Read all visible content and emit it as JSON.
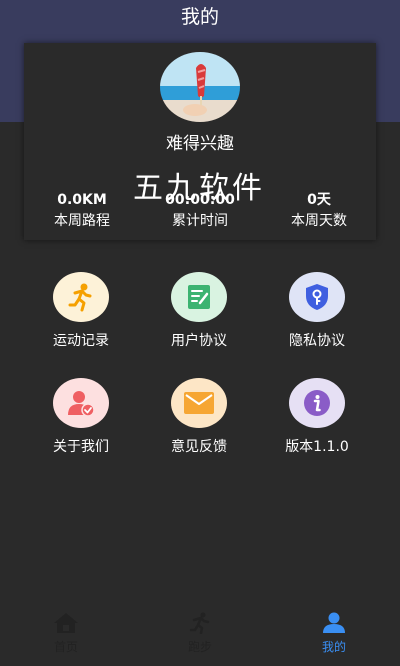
{
  "header": {
    "title": "我的"
  },
  "profile": {
    "username": "难得兴趣",
    "watermark": "五九软件",
    "stats": [
      {
        "value": "0.0KM",
        "label": "本周路程"
      },
      {
        "value": "00:00:00",
        "label": "累计时间"
      },
      {
        "value": "0天",
        "label": "本周天数"
      }
    ]
  },
  "menu": [
    {
      "label": "运动记录",
      "icon": "running-icon",
      "bg": "#fdf2d8",
      "color": "#f5a000"
    },
    {
      "label": "用户协议",
      "icon": "document-edit-icon",
      "bg": "#d9f3e1",
      "color": "#3cb371"
    },
    {
      "label": "隐私协议",
      "icon": "shield-key-icon",
      "bg": "#dfe4f6",
      "color": "#3f5fe0"
    },
    {
      "label": "关于我们",
      "icon": "user-verified-icon",
      "bg": "#fde0e0",
      "color": "#ef5f62"
    },
    {
      "label": "意见反馈",
      "icon": "mail-icon",
      "bg": "#fde6c6",
      "color": "#f6a633"
    },
    {
      "label": "版本1.1.0",
      "icon": "info-icon",
      "bg": "#e6e0f4",
      "color": "#8a5cc7"
    }
  ],
  "tabbar": {
    "tabs": [
      {
        "label": "首页",
        "icon": "home-icon",
        "active": false
      },
      {
        "label": "跑步",
        "icon": "running-icon",
        "active": false
      },
      {
        "label": "我的",
        "icon": "user-icon",
        "active": true
      }
    ],
    "inactive_color": "#222222",
    "active_color": "#3a8ff3"
  }
}
